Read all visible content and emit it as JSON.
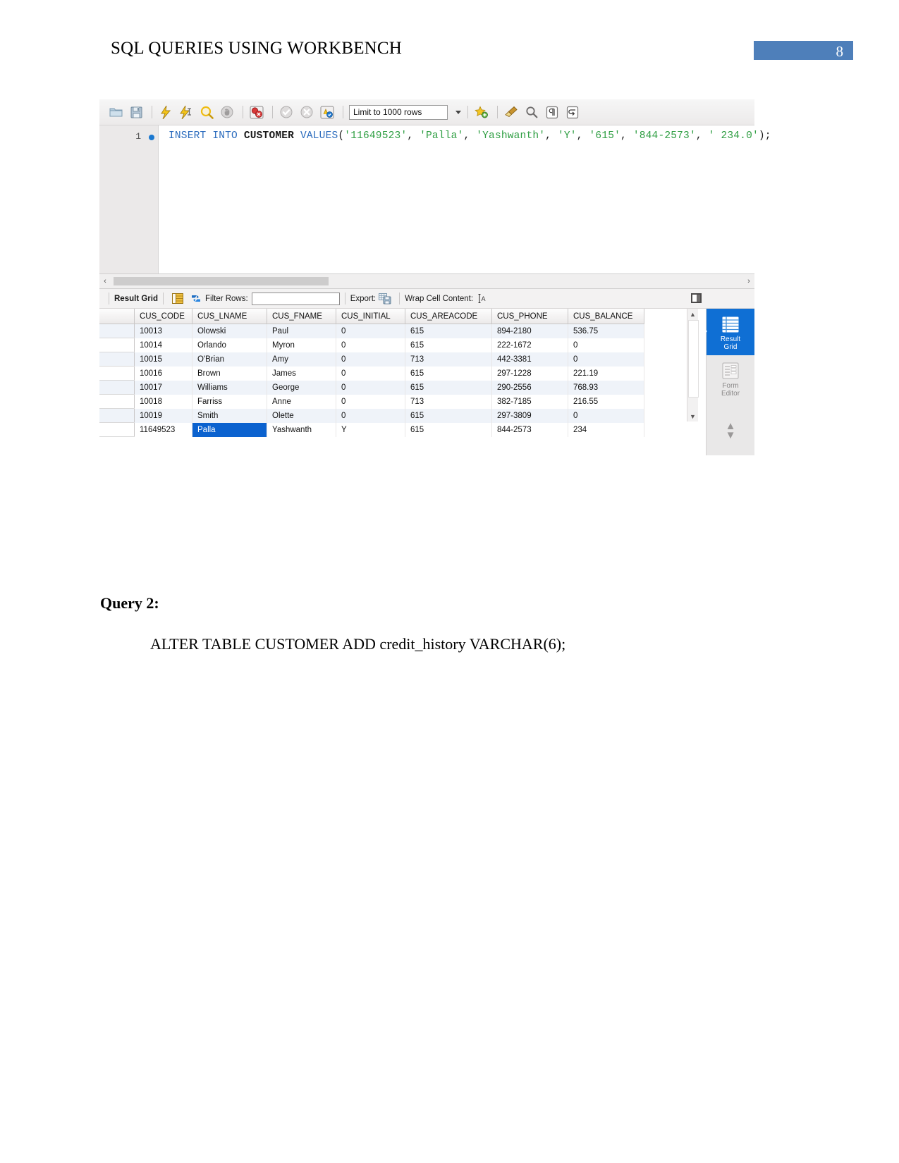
{
  "header": {
    "title": "SQL QUERIES USING WORKBENCH",
    "page_number": "8",
    "accent_color": "#4e7fba"
  },
  "workbench": {
    "toolbar": {
      "icons": [
        {
          "name": "open-sql-script-icon",
          "glyph": "folder"
        },
        {
          "name": "save-sql-script-icon",
          "glyph": "floppy"
        },
        {
          "name": "execute-statement-icon",
          "glyph": "bolt-yellow"
        },
        {
          "name": "execute-current-statement-icon",
          "glyph": "bolt-cursor"
        },
        {
          "name": "explain-query-icon",
          "glyph": "magnifier-yellow"
        },
        {
          "name": "stop-query-icon",
          "glyph": "hand-grey"
        },
        {
          "name": "toggle-stop-on-error-icon",
          "glyph": "stop-error"
        },
        {
          "name": "commit-icon",
          "glyph": "check-grey"
        },
        {
          "name": "rollback-icon",
          "glyph": "cross-grey"
        },
        {
          "name": "toggle-autocommit-icon",
          "glyph": "autocommit"
        }
      ],
      "limit_label": "Limit to 1000 rows",
      "right_icons": [
        {
          "name": "save-snippet-icon",
          "glyph": "star-plus"
        },
        {
          "name": "beautify-sql-icon",
          "glyph": "broom"
        },
        {
          "name": "find-icon",
          "glyph": "magnifier-grey"
        },
        {
          "name": "toggle-invisible-chars-icon",
          "glyph": "pilcrow"
        },
        {
          "name": "toggle-wrapping-icon",
          "glyph": "wrap-arrow"
        }
      ]
    },
    "editor": {
      "line_number": "1",
      "sql_tokens": [
        {
          "text": "INSERT",
          "type": "kw"
        },
        {
          "text": " ",
          "type": "punc"
        },
        {
          "text": "INTO",
          "type": "kw"
        },
        {
          "text": " ",
          "type": "punc"
        },
        {
          "text": "CUSTOMER",
          "type": "tbl"
        },
        {
          "text": " ",
          "type": "punc"
        },
        {
          "text": "VALUES",
          "type": "kw"
        },
        {
          "text": "(",
          "type": "punc"
        },
        {
          "text": "'11649523'",
          "type": "str"
        },
        {
          "text": ", ",
          "type": "punc"
        },
        {
          "text": "'Palla'",
          "type": "str"
        },
        {
          "text": ", ",
          "type": "punc"
        },
        {
          "text": "'Yashwanth'",
          "type": "str"
        },
        {
          "text": ", ",
          "type": "punc"
        },
        {
          "text": "'Y'",
          "type": "str"
        },
        {
          "text": ", ",
          "type": "punc"
        },
        {
          "text": "'615'",
          "type": "str"
        },
        {
          "text": ", ",
          "type": "punc"
        },
        {
          "text": "'844-2573'",
          "type": "str"
        },
        {
          "text": ", ",
          "type": "punc"
        },
        {
          "text": "' 234.0'",
          "type": "str"
        },
        {
          "text": ");",
          "type": "punc"
        }
      ],
      "sql_full": "INSERT INTO CUSTOMER VALUES('11649523', 'Palla', 'Yashwanth', 'Y', '615', '844-2573', ' 234.0');"
    },
    "grid_toolbar": {
      "result_grid_label": "Result Grid",
      "filter_rows_label": "Filter Rows:",
      "filter_value": "",
      "export_label": "Export:",
      "wrap_cell_content_label": "Wrap Cell Content:"
    },
    "result_table": {
      "columns": [
        "CUS_CODE",
        "CUS_LNAME",
        "CUS_FNAME",
        "CUS_INITIAL",
        "CUS_AREACODE",
        "CUS_PHONE",
        "CUS_BALANCE"
      ],
      "rows": [
        {
          "cells": [
            "10013",
            "Olowski",
            "Paul",
            "0",
            "615",
            "894-2180",
            "536.75"
          ],
          "selected_col": -1
        },
        {
          "cells": [
            "10014",
            "Orlando",
            "Myron",
            "0",
            "615",
            "222-1672",
            "0"
          ],
          "selected_col": -1
        },
        {
          "cells": [
            "10015",
            "O'Brian",
            "Amy",
            "0",
            "713",
            "442-3381",
            "0"
          ],
          "selected_col": -1
        },
        {
          "cells": [
            "10016",
            "Brown",
            "James",
            "0",
            "615",
            "297-1228",
            "221.19"
          ],
          "selected_col": -1
        },
        {
          "cells": [
            "10017",
            "Williams",
            "George",
            "0",
            "615",
            "290-2556",
            "768.93"
          ],
          "selected_col": -1
        },
        {
          "cells": [
            "10018",
            "Farriss",
            "Anne",
            "0",
            "713",
            "382-7185",
            "216.55"
          ],
          "selected_col": -1
        },
        {
          "cells": [
            "10019",
            "Smith",
            "Olette",
            "0",
            "615",
            "297-3809",
            "0"
          ],
          "selected_col": -1
        },
        {
          "cells": [
            "11649523",
            "Palla",
            "Yashwanth",
            "Y",
            "615",
            "844-2573",
            "234"
          ],
          "selected_col": 1
        }
      ]
    },
    "side_tabs": [
      {
        "name": "result-grid",
        "label_line1": "Result",
        "label_line2": "Grid",
        "active": true
      },
      {
        "name": "form-editor",
        "label_line1": "Form",
        "label_line2": "Editor",
        "active": false
      }
    ]
  },
  "body_text": {
    "query_label": "Query 2:",
    "query_sql": "ALTER TABLE CUSTOMER ADD credit_history VARCHAR(6);"
  }
}
